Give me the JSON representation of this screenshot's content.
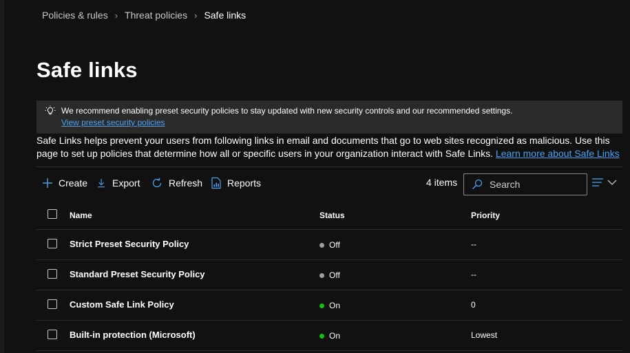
{
  "breadcrumb": {
    "items": [
      "Policies & rules",
      "Threat policies",
      "Safe links"
    ]
  },
  "page": {
    "title": "Safe links"
  },
  "banner": {
    "message": "We recommend enabling preset security policies to stay updated with new security controls and our recommended settings.",
    "link": "View preset security policies",
    "icon": "lightbulb-icon"
  },
  "description": {
    "text": "Safe Links helps prevent your users from following links in email and documents that go to web sites recognized as malicious. Use this page to set up policies that determine how all or specific users in your organization interact with Safe Links.",
    "link": "Learn more about Safe Links"
  },
  "toolbar": {
    "create": "Create",
    "export": "Export",
    "refresh": "Refresh",
    "reports": "Reports",
    "item_count": "4 items",
    "search_placeholder": "Search"
  },
  "table": {
    "headers": {
      "name": "Name",
      "status": "Status",
      "priority": "Priority"
    },
    "rows": [
      {
        "name": "Strict Preset Security Policy",
        "status": "Off",
        "status_color": "#9e9e9e",
        "priority": "--"
      },
      {
        "name": "Standard Preset Security Policy",
        "status": "Off",
        "status_color": "#9e9e9e",
        "priority": "--"
      },
      {
        "name": "Custom Safe Link Policy",
        "status": "On",
        "status_color": "#13c213",
        "priority": "0"
      },
      {
        "name": "Built-in protection (Microsoft)",
        "status": "On",
        "status_color": "#13c213",
        "priority": "Lowest"
      }
    ]
  },
  "colors": {
    "accent": "#4ea1f0",
    "background": "#111111",
    "banner": "#2a2a2a"
  }
}
